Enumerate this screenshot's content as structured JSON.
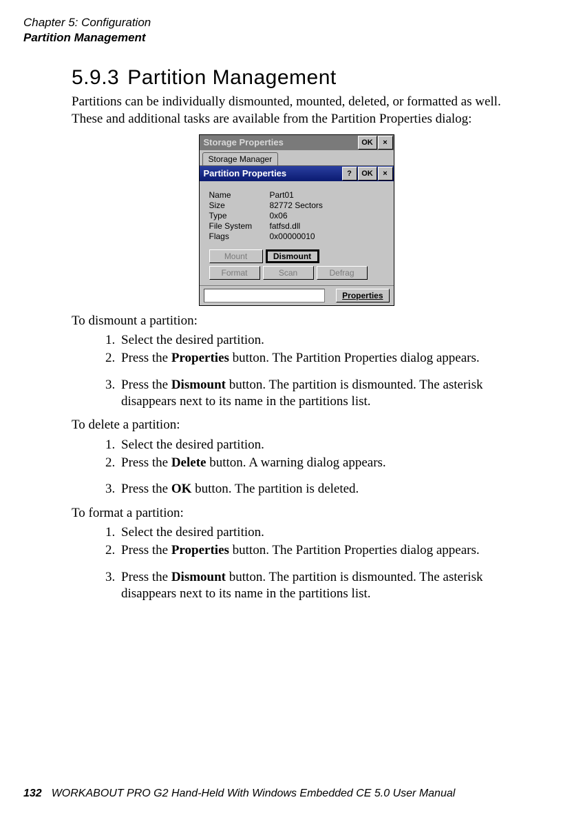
{
  "header": {
    "chapter_line": "Chapter 5: Configuration",
    "topic_line": "Partition Management"
  },
  "section": {
    "number": "5.9.3",
    "title": "Partition Management",
    "intro": "Partitions can be individually dismounted, mounted, deleted, or formatted as well. These and additional tasks are available from the Partition Properties dialog:"
  },
  "screenshot": {
    "outer_title": "Storage Properties",
    "outer_ok": "OK",
    "outer_close": "×",
    "tab_label": "Storage Manager",
    "inner_title": "Partition Properties",
    "inner_help": "?",
    "inner_ok": "OK",
    "inner_close": "×",
    "props": [
      {
        "k": "Name",
        "v": "Part01"
      },
      {
        "k": "Size",
        "v": "82772 Sectors"
      },
      {
        "k": "Type",
        "v": "0x06"
      },
      {
        "k": "File System",
        "v": "fatfsd.dll"
      },
      {
        "k": "Flags",
        "v": "0x00000010"
      }
    ],
    "buttons_row1": {
      "mount": "Mount",
      "dismount": "Dismount"
    },
    "buttons_row2": {
      "format": "Format",
      "scan": "Scan",
      "defrag": "Defrag"
    },
    "bottom_button": "Properties"
  },
  "dismount": {
    "lead": "To dismount a partition:",
    "s1": "Select the desired partition.",
    "s2a": "Press the ",
    "s2b": "Properties",
    "s2c": " button. The Partition Properties dialog appears.",
    "s3a": "Press the ",
    "s3b": "Dismount",
    "s3c": " button. The partition is dismounted. The asterisk disappears next to its name in the partitions list."
  },
  "delete": {
    "lead": "To delete a partition:",
    "s1": "Select the desired partition.",
    "s2a": "Press the ",
    "s2b": "Delete",
    "s2c": " button. A warning dialog appears.",
    "s3a": "Press the ",
    "s3b": "OK",
    "s3c": " button. The partition is deleted."
  },
  "format": {
    "lead": "To format a partition:",
    "s1": "Select the desired partition.",
    "s2a": "Press the ",
    "s2b": "Properties",
    "s2c": " button. The Partition Properties dialog appears.",
    "s3a": "Press the ",
    "s3b": "Dismount",
    "s3c": " button. The partition is dismounted. The asterisk disappears next to its name in the partitions list."
  },
  "footer": {
    "page_number": "132",
    "book_title": "WORKABOUT PRO G2 Hand-Held With Windows Embedded CE 5.0 User Manual"
  }
}
